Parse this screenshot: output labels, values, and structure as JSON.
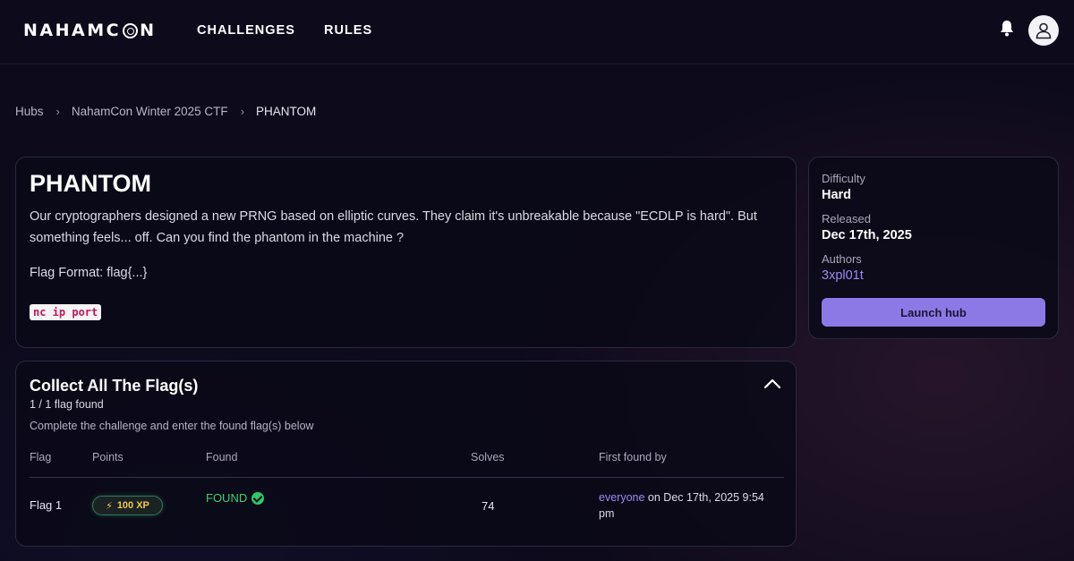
{
  "header": {
    "logo": "NAHAMCON",
    "nav": [
      {
        "label": "CHALLENGES"
      },
      {
        "label": "RULES"
      }
    ]
  },
  "breadcrumb": {
    "items": [
      "Hubs",
      "NahamCon Winter 2025 CTF",
      "PHANTOM"
    ]
  },
  "challenge": {
    "title": "PHANTOM",
    "description": "Our cryptographers designed a new PRNG based on elliptic curves. They claim it's unbreakable because \"ECDLP is hard\". But something feels... off. Can you find the phantom in the machine ?",
    "flag_format": "Flag Format: flag{...}",
    "connection": "nc ip port"
  },
  "sidebar": {
    "difficulty_label": "Difficulty",
    "difficulty_value": "Hard",
    "released_label": "Released",
    "released_value": "Dec 17th, 2025",
    "authors_label": "Authors",
    "authors_value": "3xpl01t",
    "launch_label": "Launch hub"
  },
  "flags": {
    "title": "Collect All The Flag(s)",
    "found_count": "1 / 1 flag found",
    "instructions": "Complete the challenge and enter the found flag(s) below",
    "columns": [
      "Flag",
      "Points",
      "Found",
      "Solves",
      "First found by"
    ],
    "rows": [
      {
        "flag": "Flag 1",
        "points": "100 XP",
        "found": "FOUND",
        "solves": "74",
        "first_found_user": "everyone",
        "first_found_time": " on Dec 17th, 2025 9:54 pm"
      }
    ]
  },
  "colors": {
    "accent": "#8c79e6",
    "link": "#9a8cf0",
    "success": "#3bd16f",
    "xp": "#f0c84a",
    "background": "#0c0a1b"
  }
}
